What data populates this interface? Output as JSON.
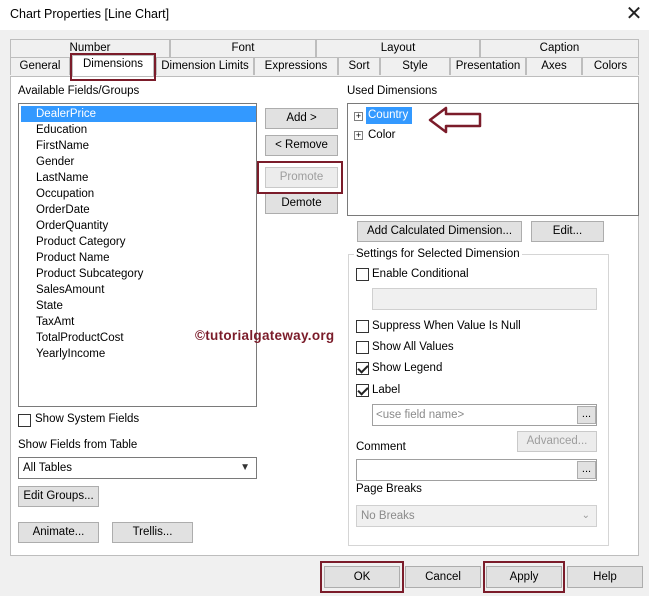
{
  "window": {
    "title": "Chart Properties [Line Chart]",
    "close_glyph": "✕"
  },
  "tabs_row1": [
    "Number",
    "Font",
    "Layout",
    "Caption"
  ],
  "tabs_row2": [
    "General",
    "Dimensions",
    "Dimension Limits",
    "Expressions",
    "Sort",
    "Style",
    "Presentation",
    "Axes",
    "Colors"
  ],
  "left": {
    "available_label": "Available Fields/Groups",
    "fields": [
      "DealerPrice",
      "Education",
      "FirstName",
      "Gender",
      "LastName",
      "Occupation",
      "OrderDate",
      "OrderQuantity",
      "Product Category",
      "Product Name",
      "Product Subcategory",
      "SalesAmount",
      "State",
      "TaxAmt",
      "TotalProductCost",
      "YearlyIncome"
    ],
    "selected_field": "DealerPrice",
    "show_system_fields": "Show System Fields",
    "show_fields_from_table": "Show Fields from Table",
    "table_value": "All Tables",
    "edit_groups": "Edit Groups...",
    "animate": "Animate...",
    "trellis": "Trellis..."
  },
  "middle": {
    "add": "Add >",
    "remove": "< Remove",
    "promote": "Promote",
    "demote": "Demote"
  },
  "right": {
    "used_label": "Used Dimensions",
    "used": [
      "Country",
      "Color"
    ],
    "add_calculated": "Add Calculated Dimension...",
    "edit": "Edit...",
    "settings_title": "Settings for Selected Dimension",
    "enable_conditional": "Enable Conditional",
    "suppress_null": "Suppress When Value Is Null",
    "show_all_values": "Show All Values",
    "show_legend": "Show Legend",
    "label": "Label",
    "label_placeholder": "<use field name>",
    "advanced": "Advanced...",
    "comment": "Comment",
    "page_breaks": "Page Breaks",
    "page_breaks_value": "No Breaks",
    "ellipsis": "...",
    "checks": {
      "enable_conditional": false,
      "suppress_null": false,
      "show_all_values": false,
      "show_legend": true,
      "label": true
    }
  },
  "footer": {
    "ok": "OK",
    "cancel": "Cancel",
    "apply": "Apply",
    "help": "Help"
  },
  "watermark": "©tutorialgateway.org",
  "colors": {
    "highlight": "#7b1c2a",
    "selection": "#3399ff"
  }
}
